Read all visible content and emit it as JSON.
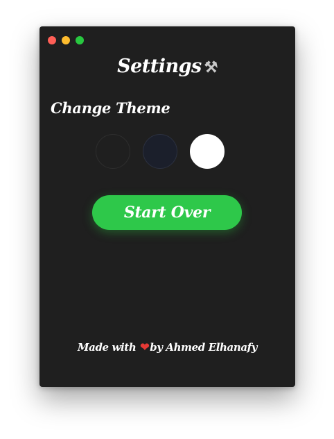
{
  "window": {
    "controls": [
      "close",
      "minimize",
      "maximize"
    ]
  },
  "header": {
    "title": "Settings",
    "title_icon": "⚒",
    "title_icon_name": "hammer-and-wrench-icon"
  },
  "theme": {
    "label": "Change Theme",
    "options": [
      {
        "name": "dark",
        "color": "#1f1f1f",
        "border": "#2e2e2e"
      },
      {
        "name": "navy",
        "color": "#1b1f2b",
        "border": "#2c3140"
      },
      {
        "name": "light",
        "color": "#ffffff",
        "border": "#ffffff"
      }
    ]
  },
  "actions": {
    "start_over_label": "Start Over",
    "accent_color": "#2ec84a"
  },
  "footer": {
    "prefix": "Made with",
    "heart": "❤",
    "suffix": "by Ahmed Elhanafy"
  }
}
